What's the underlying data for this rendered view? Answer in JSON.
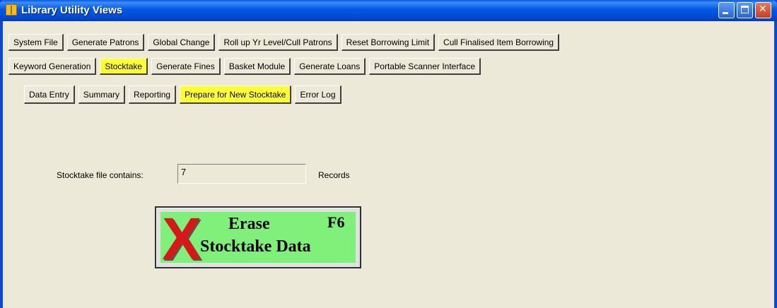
{
  "window": {
    "title": "Library Utility Views"
  },
  "tabs_row1": [
    {
      "label": "System File"
    },
    {
      "label": "Generate Patrons"
    },
    {
      "label": "Global Change"
    },
    {
      "label": "Roll up Yr Level/Cull Patrons"
    },
    {
      "label": "Reset Borrowing Limit"
    },
    {
      "label": "Cull Finalised Item Borrowing"
    }
  ],
  "tabs_row2": [
    {
      "label": "Keyword Generation"
    },
    {
      "label": "Stocktake",
      "active": true
    },
    {
      "label": "Generate Fines"
    },
    {
      "label": "Basket Module"
    },
    {
      "label": "Generate Loans"
    },
    {
      "label": "Portable Scanner Interface"
    }
  ],
  "tabs_row3": [
    {
      "label": "Data Entry"
    },
    {
      "label": "Summary"
    },
    {
      "label": "Reporting"
    },
    {
      "label": "Prepare for New Stocktake",
      "active": true
    },
    {
      "label": "Error Log"
    }
  ],
  "stocktake": {
    "label": "Stocktake file contains:",
    "value": "7",
    "unit": "Records"
  },
  "erase_button": {
    "x_glyph": "X",
    "line1": "Erase",
    "key": "F6",
    "line2": "Stocktake Data"
  },
  "colors": {
    "active_tab": "#ffff33",
    "erase_face": "#7ff07a",
    "erase_x": "#d81818",
    "titlebar": "#0058e6"
  }
}
